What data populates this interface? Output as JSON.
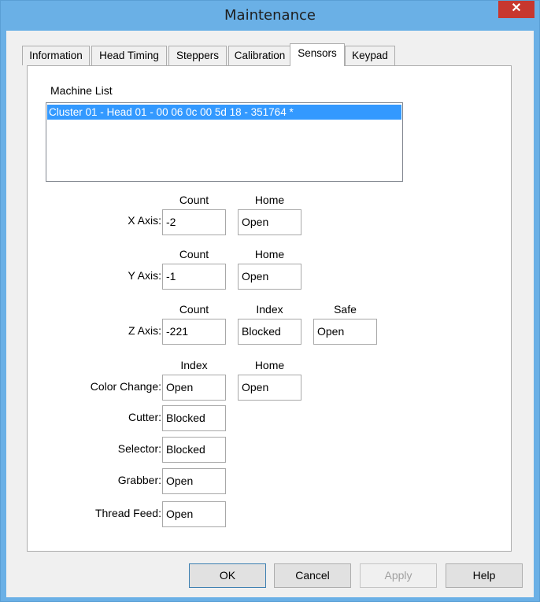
{
  "window": {
    "title": "Maintenance",
    "close_glyph": "✕"
  },
  "tabs": [
    {
      "label": "Information"
    },
    {
      "label": "Head Timing"
    },
    {
      "label": "Steppers"
    },
    {
      "label": "Calibration"
    },
    {
      "label": "Sensors",
      "active": true
    },
    {
      "label": "Keypad"
    }
  ],
  "machine_list": {
    "label": "Machine List",
    "items": [
      "Cluster 01 - Head 01 - 00 06 0c 00 5d 18 - 351764 *"
    ]
  },
  "sensors": {
    "x_axis": {
      "label": "X Axis:",
      "col1": "Count",
      "col2": "Home",
      "v1": "-2",
      "v2": "Open"
    },
    "y_axis": {
      "label": "Y Axis:",
      "col1": "Count",
      "col2": "Home",
      "v1": "-1",
      "v2": "Open"
    },
    "z_axis": {
      "label": "Z Axis:",
      "col1": "Count",
      "col2": "Index",
      "col3": "Safe",
      "v1": "-221",
      "v2": "Blocked",
      "v3": "Open"
    },
    "color_change": {
      "label": "Color Change:",
      "col1": "Index",
      "col2": "Home",
      "v1": "Open",
      "v2": "Open"
    },
    "cutter": {
      "label": "Cutter:",
      "v1": "Blocked"
    },
    "selector": {
      "label": "Selector:",
      "v1": "Blocked"
    },
    "grabber": {
      "label": "Grabber:",
      "v1": "Open"
    },
    "thread_feed": {
      "label": "Thread Feed:",
      "v1": "Open"
    }
  },
  "buttons": {
    "ok": "OK",
    "cancel": "Cancel",
    "apply": "Apply",
    "help": "Help"
  }
}
